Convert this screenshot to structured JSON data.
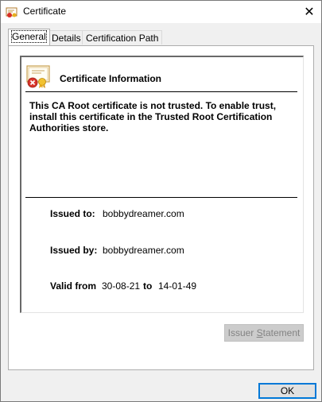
{
  "window": {
    "title": "Certificate",
    "close_label": "✕"
  },
  "tabs": [
    {
      "label": "General",
      "active": true
    },
    {
      "label": "Details",
      "active": false
    },
    {
      "label": "Certification Path",
      "active": false
    }
  ],
  "general": {
    "heading": "Certificate Information",
    "warning": "This CA Root certificate is not trusted. To enable trust, install this certificate in the Trusted Root Certification Authorities store.",
    "issued_to_label": "Issued to:",
    "issued_to_value": "bobbydreamer.com",
    "issued_by_label": "Issued by:",
    "issued_by_value": "bobbydreamer.com",
    "valid_from_label": "Valid from",
    "valid_from_value": "30-08-21",
    "valid_to_label": "to",
    "valid_to_value": "14-01-49",
    "issuer_statement_prefix": "Issuer ",
    "issuer_statement_underlined": "S",
    "issuer_statement_suffix": "tatement",
    "issuer_statement_enabled": false
  },
  "footer": {
    "ok_label": "OK"
  },
  "colors": {
    "accent": "#0078d7",
    "disabled_button_bg": "#cccccc",
    "disabled_text": "#838383"
  },
  "icons": {
    "title": "certificate-icon",
    "cert": "certificate-error-icon",
    "close": "close-icon"
  }
}
